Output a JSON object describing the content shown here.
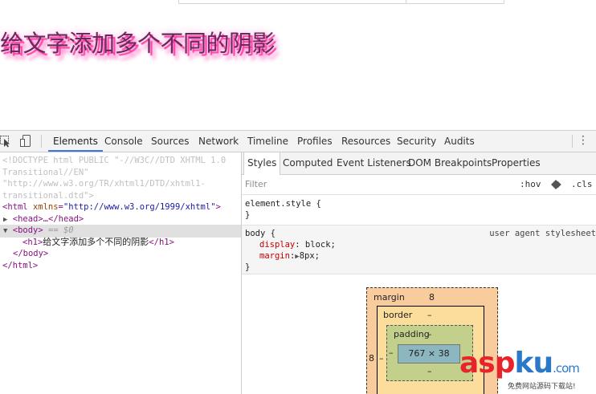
{
  "page": {
    "heading": "给文字添加多个不同的阴影"
  },
  "devtools": {
    "tabs": [
      "Elements",
      "Console",
      "Sources",
      "Network",
      "Timeline",
      "Profiles",
      "Resources",
      "Security",
      "Audits"
    ],
    "active_tab": "Elements",
    "kebab": "⋮",
    "elements": {
      "doctype_line1": "<!DOCTYPE html PUBLIC \"-//W3C//DTD XHTML 1.0",
      "doctype_line2": "Transitional//EN\"",
      "doctype_line3": "\"http://www.w3.org/TR/xhtml1/DTD/xhtml1-",
      "doctype_line4": "transitional.dtd\">",
      "html_open_tag": "<html",
      "html_attr": "xmlns",
      "html_attr_val": "\"http://www.w3.org/1999/xhtml\"",
      "html_open_end": ">",
      "head_line": "<head>…</head>",
      "body_open": "<body>",
      "body_marker": "== $0",
      "h1_open": "<h1>",
      "h1_text": "给文字添加多个不同的阴影",
      "h1_close": "</h1>",
      "body_close": "</body>",
      "html_close": "</html>"
    },
    "styles": {
      "subtabs": [
        "Styles",
        "Computed",
        "Event Listeners",
        "DOM Breakpoints",
        "Properties"
      ],
      "active_subtab": "Styles",
      "filter_placeholder": "Filter",
      "hov": ":hov",
      "cls": ".cls",
      "element_style_selector": "element.style {",
      "element_style_close": "}",
      "body_rule_selector": "body {",
      "body_rule_source": "user agent stylesheet",
      "body_rule_props": [
        {
          "name": "display",
          "value": "block;"
        },
        {
          "name": "margin",
          "value": "8px;"
        }
      ],
      "body_rule_close": "}"
    },
    "box_model": {
      "margin_label": "margin",
      "margin_top": "8",
      "margin_left": "8",
      "border_label": "border",
      "border_top": "–",
      "border_left": "–",
      "padding_label": "padding",
      "padding_top": "–",
      "padding_left": "–",
      "padding_bottom": "–",
      "content_size": "767 × 38"
    }
  },
  "watermark": {
    "brand_asp": "asp",
    "brand_ku": "ku",
    "brand_com": ".com",
    "subtitle": "免费网站源码下载站!"
  },
  "colors": {
    "tab_active_underline": "#3879d9",
    "tag": "#881280",
    "attr": "#994500",
    "attr_value": "#1a1aa6",
    "prop_name": "#c80000",
    "margin_box": "#f9cc9d",
    "border_box": "#fddd9b",
    "padding_box": "#c3d08b",
    "content_box": "#8cb6c0",
    "heading_shadow": "#ff3fa6"
  }
}
